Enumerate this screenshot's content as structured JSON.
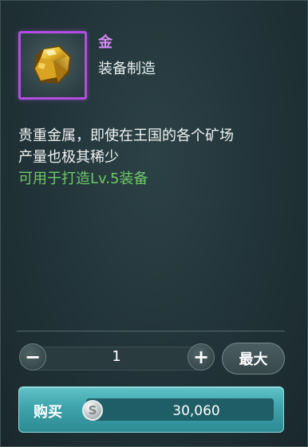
{
  "item": {
    "name": "金",
    "category": "装备制造",
    "icon": "gold-ore-icon",
    "rarity_color": "#b24fe0"
  },
  "description": {
    "line1": "贵重金属，即使在王国的各个矿场",
    "line2": "产量也极其稀少",
    "usage": "可用于打造Lv.5装备"
  },
  "quantity": {
    "decrement_label": "−",
    "value": "1",
    "increment_label": "+",
    "max_label": "最大"
  },
  "purchase": {
    "buy_label": "购买",
    "currency_icon": "silver-coin-icon",
    "currency_symbol": "S",
    "price": "30,060"
  }
}
